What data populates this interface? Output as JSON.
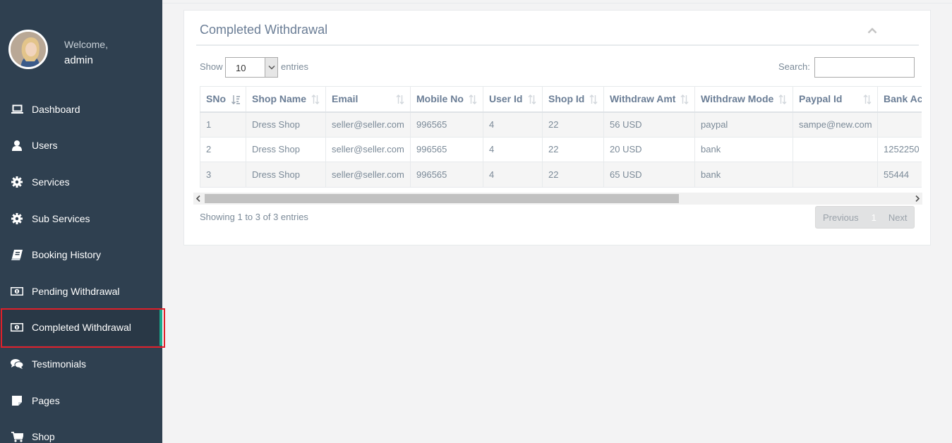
{
  "user": {
    "welcome": "Welcome,",
    "name": "admin"
  },
  "sidebar": {
    "items": [
      {
        "label": "Dashboard",
        "icon": "laptop-icon"
      },
      {
        "label": "Users",
        "icon": "user-icon"
      },
      {
        "label": "Services",
        "icon": "gear-icon"
      },
      {
        "label": "Sub Services",
        "icon": "gear-icon"
      },
      {
        "label": "Booking History",
        "icon": "book-icon"
      },
      {
        "label": "Pending Withdrawal",
        "icon": "money-icon"
      },
      {
        "label": "Completed Withdrawal",
        "icon": "money-icon",
        "active": true
      },
      {
        "label": "Testimonials",
        "icon": "comments-icon"
      },
      {
        "label": "Pages",
        "icon": "sticky-note-icon"
      },
      {
        "label": "Shop",
        "icon": "cart-icon"
      }
    ]
  },
  "panel": {
    "title": "Completed Withdrawal"
  },
  "controls": {
    "show_label": "Show",
    "entries_value": "10",
    "entries_label": "entries",
    "search_label": "Search:",
    "search_value": ""
  },
  "table": {
    "headers": [
      "SNo",
      "Shop Name",
      "Email",
      "Mobile No",
      "User Id",
      "Shop Id",
      "Withdraw Amt",
      "Withdraw Mode",
      "Paypal Id",
      "Bank Acc"
    ],
    "rows": [
      [
        "1",
        "Dress Shop",
        "seller@seller.com",
        "996565",
        "4",
        "22",
        "56 USD",
        "paypal",
        "sampe@new.com",
        ""
      ],
      [
        "2",
        "Dress Shop",
        "seller@seller.com",
        "996565",
        "4",
        "22",
        "20 USD",
        "bank",
        "",
        "1252250"
      ],
      [
        "3",
        "Dress Shop",
        "seller@seller.com",
        "996565",
        "4",
        "22",
        "65 USD",
        "bank",
        "",
        "55444"
      ]
    ]
  },
  "footer": {
    "info": "Showing 1 to 3 of 3 entries",
    "previous": "Previous",
    "page": "1",
    "next": "Next"
  },
  "colors": {
    "sidebar": "#2f4050",
    "accent": "#19aa8d",
    "highlight": "#e0202a"
  }
}
